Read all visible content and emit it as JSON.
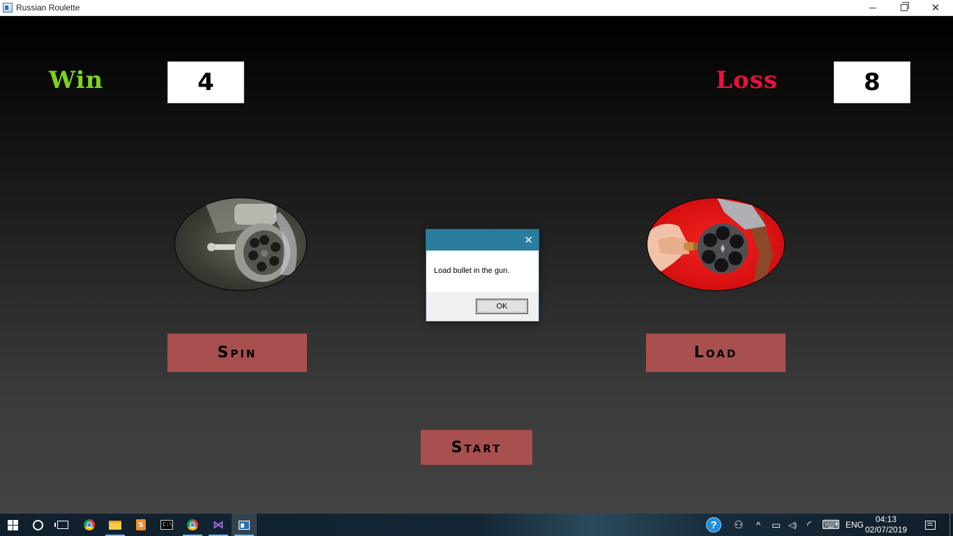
{
  "window": {
    "title": "Russian Roulette",
    "minimize_glyph": "",
    "close_glyph": "✕"
  },
  "game": {
    "win_label": "Win",
    "win_count": "4",
    "loss_label": "Loss",
    "loss_count": "8",
    "spin_button": "Spin",
    "load_button": "Load",
    "start_button": "Start",
    "spin_image": "revolver-cylinder-photo",
    "load_image": "loading-bullet-photo",
    "colors": {
      "win": "#7cd31a",
      "loss": "#e8123a",
      "button": "#a84f4f",
      "load_image_bg": "#e00000"
    }
  },
  "dialog": {
    "close_glyph": "✕",
    "message": "Load bullet in the gun.",
    "ok_button": "OK",
    "title_color": "#2a7d9f"
  },
  "taskbar": {
    "icons": [
      "windows-start-icon",
      "cortana-icon",
      "task-view-icon",
      "chrome-icon",
      "file-explorer-icon",
      "sublime-text-icon",
      "command-prompt-icon",
      "chrome-icon",
      "visual-studio-icon",
      "app-window-icon"
    ],
    "sublime_glyph": "S",
    "cmd_glyph": "C:\\",
    "vs_glyph": "⋈",
    "help_glyph": "?",
    "people_glyph": "⚇",
    "chevron_glyph": "^",
    "battery_glyph": "▭",
    "volume_glyph": "◁)",
    "wifi_glyph": "◜",
    "keyboard_glyph": "⌨",
    "language": "ENG",
    "time": "04:13",
    "date": "02/07/2019"
  }
}
